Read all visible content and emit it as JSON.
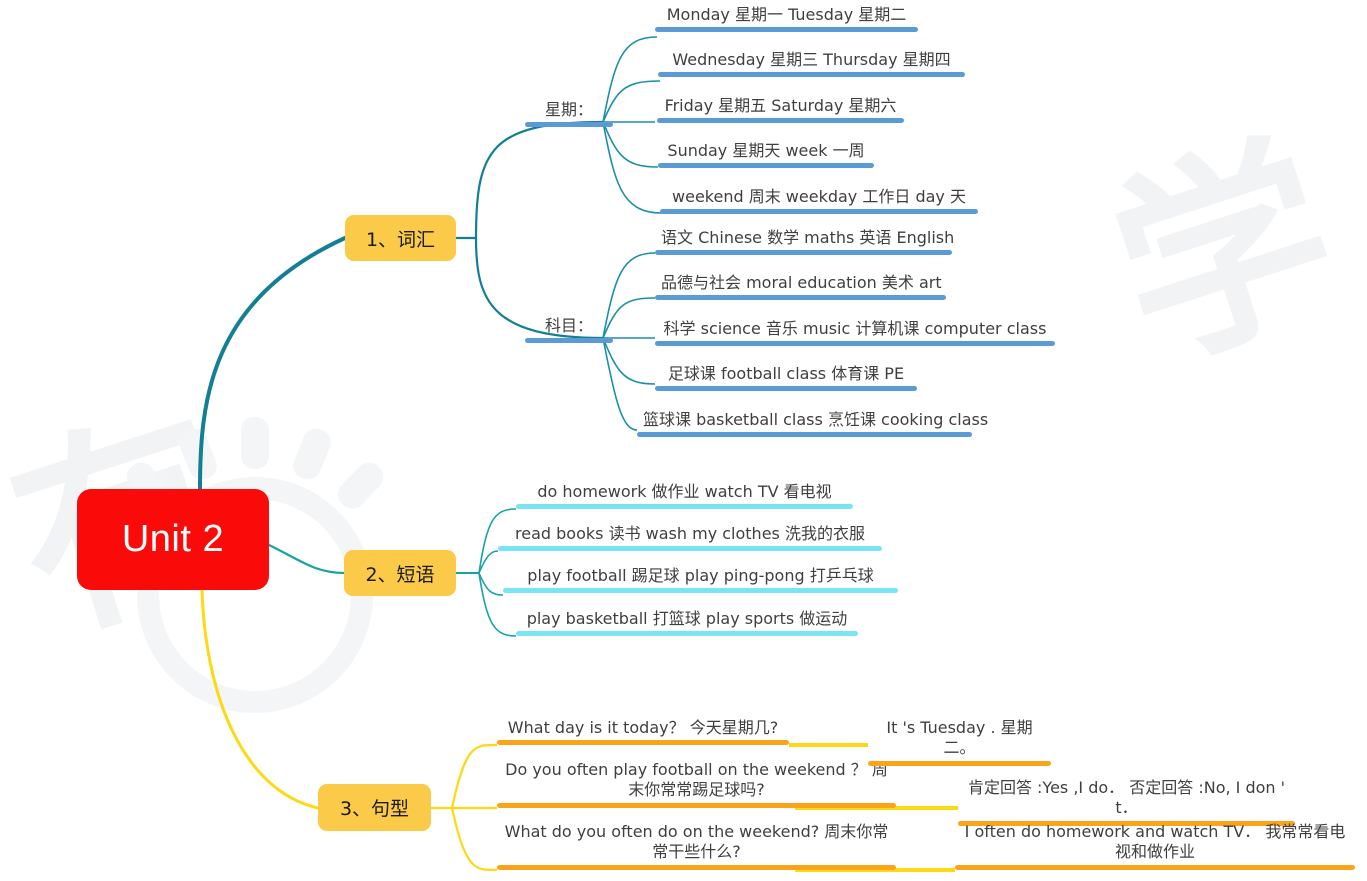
{
  "mindmap": {
    "root": {
      "label": "Unit 2",
      "color": "#fb0a0a"
    },
    "watermark_chars": [
      "有",
      "学"
    ],
    "branches": [
      {
        "id": "vocabulary",
        "label": "1、词汇",
        "color": "#fbca49",
        "line_color": "#1b7f94",
        "underline_color": "#5b9bd5",
        "groups": [
          {
            "label": "星期：",
            "items": [
              "Monday  星期一 Tuesday  星期二",
              "Wednesday   星期三   Thursday 星期四",
              "Friday  星期五 Saturday  星期六",
              "Sunday  星期天  week  一周",
              "weekend  周末  weekday  工作日  day  天"
            ]
          },
          {
            "label": "科目：",
            "items": [
              "语文 Chinese  数学 maths  英语 English",
              "品德与社会 moral education   美术 art",
              "科学 science    音乐 music  计算机课 computer class",
              "足球课 football class  体育课  PE",
              "篮球课 basketball class  烹饪课  cooking class"
            ]
          }
        ]
      },
      {
        "id": "phrases",
        "label": "2、短语",
        "color": "#fbca49",
        "line_color": "#17a3a3",
        "underline_color": "#79e4f4",
        "items": [
          "do homework  做作业  watch TV  看电视",
          "read books  读书   wash my clothes  洗我的衣服",
          "play football  踢足球  play ping-pong  打乒乓球",
          "play basketball  打篮球  play sports  做运动"
        ]
      },
      {
        "id": "sentences",
        "label": "3、句型",
        "color": "#fbca49",
        "line_color": "#fcd913",
        "underline_color": "#fba41a",
        "pairs": [
          {
            "question": "What day is it today？ 今天星期几?",
            "answer": "It 's  Tuesday . 星期二。"
          },
          {
            "question": "Do you often play football on the weekend ？ 周末你常常踢足球吗?",
            "answer": "肯定回答 :Yes ,I do． 否定回答 :No, I don '  t．"
          },
          {
            "question": "What do you  often  do on  the weekend? 周末你常常干些什么?",
            "answer": "I  often  do homework  and  watch TV． 我常常看电视和做作业"
          }
        ]
      }
    ]
  }
}
